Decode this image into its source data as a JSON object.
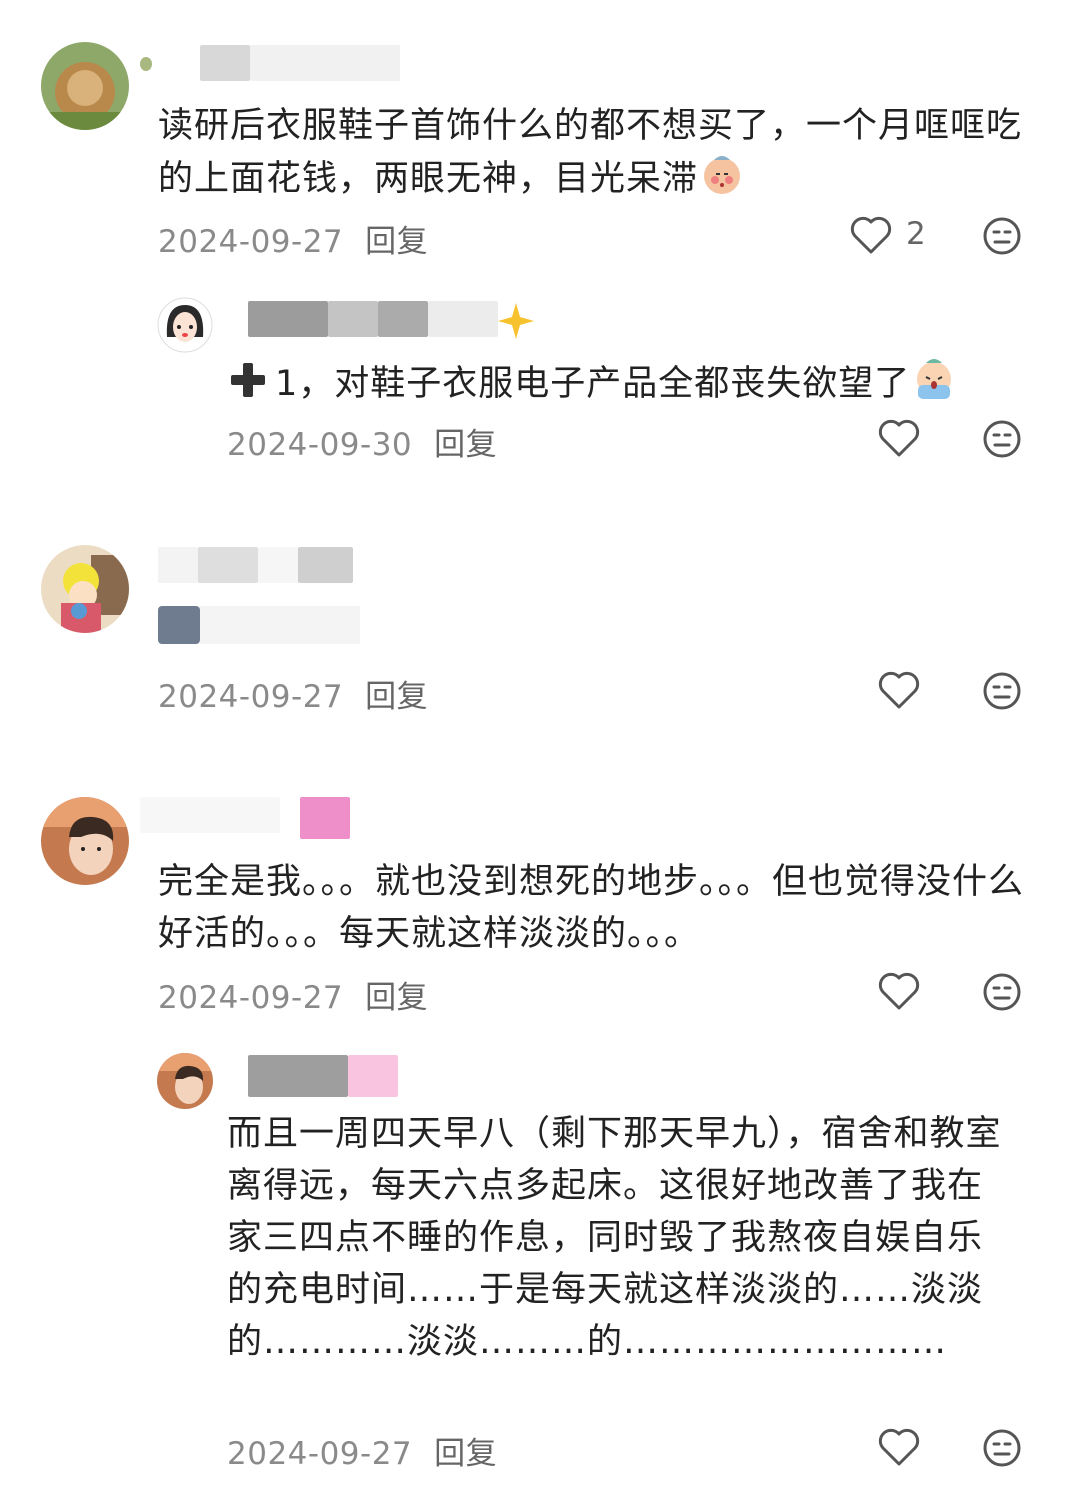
{
  "comments": [
    {
      "text": "读研后衣服鞋子首饰什么的都不想买了，一个月哐哐吃的上面花钱，两眼无神，目光呆滞",
      "emoji": "pensive-sick-emoji",
      "date": "2024-09-27",
      "reply": "回复",
      "likes": "2",
      "replies": [
        {
          "prefix_icon": "heavy-plus-icon",
          "text": "1，对鞋子衣服电子产品全都丧失欲望了",
          "emoji": "crying-emoji",
          "date": "2024-09-30",
          "reply": "回复"
        }
      ]
    },
    {
      "text": "",
      "date": "2024-09-27",
      "reply": "回复"
    },
    {
      "text": "完全是我。。。就也没到想死的地步。。。但也觉得没什么好活的。。。每天就这样淡淡的。。。",
      "date": "2024-09-27",
      "reply": "回复",
      "replies": [
        {
          "text": "而且一周四天早八（剩下那天早九），宿舍和教室离得远，每天六点多起床。这很好地改善了我在家三四点不睡的作息，同时毁了我熬夜自娱自乐的充电时间……于是每天就这样淡淡的……淡淡的…………淡淡………的………………………",
          "date": "2024-09-27",
          "reply": "回复"
        }
      ]
    }
  ],
  "colors": {
    "text": "#222222",
    "meta": "#8a8a8a",
    "icon": "#555555",
    "blur_gray": "#cfcfcf",
    "blur_pink": "#ee8fc9"
  }
}
